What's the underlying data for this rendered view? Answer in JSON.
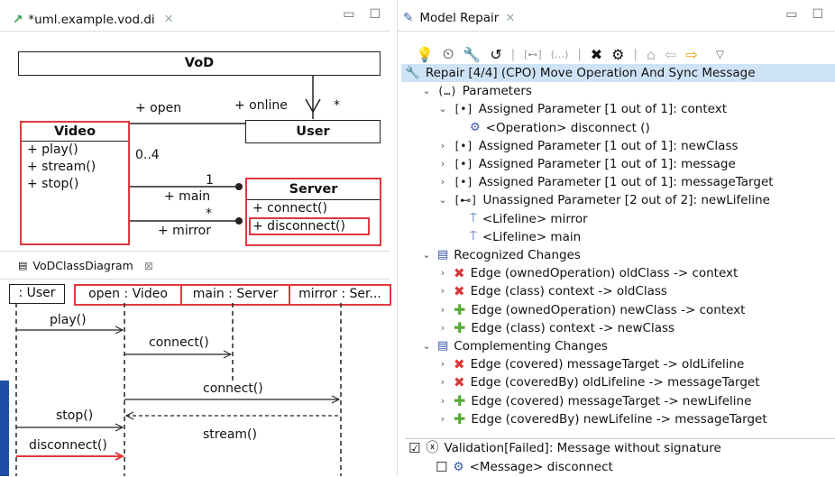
{
  "left_editor": {
    "tab_title": "*uml.example.vod.di",
    "class_diagram": {
      "vod_class": "VoD",
      "video_class": {
        "name": "Video",
        "ops": [
          "+ play()",
          "+ stream()",
          "+ stop()"
        ]
      },
      "user_class": "User",
      "server_class": {
        "name": "Server",
        "ops": [
          "+ connect()",
          "+ disconnect()"
        ]
      },
      "labels": {
        "open": "+ open",
        "online": "+ online",
        "star1": "*",
        "mult_04": "0..4",
        "one": "1",
        "main": "+ main",
        "star2": "*",
        "mirror": "+ mirror"
      }
    },
    "diagram_tab": "VoDClassDiagram",
    "sequence": {
      "lifelines": [
        ": User",
        "open : Video",
        "main : Server",
        "mirror : Ser..."
      ],
      "messages": [
        "play()",
        "connect()",
        "connect()",
        "stop()",
        "stream()",
        "disconnect()"
      ]
    }
  },
  "right_panel": {
    "tab_title": "Model Repair",
    "tree": [
      {
        "text": "Repair [4/4] (CPO) Move Operation And Sync Message",
        "indent": 0,
        "icon": "wrench-icon",
        "chev": "",
        "selected": true
      },
      {
        "text": "Parameters",
        "indent": 1,
        "icon": "param-group-icon",
        "chev": "v"
      },
      {
        "text": "Assigned Parameter [1 out of 1]: context",
        "indent": 2,
        "icon": "param-icon",
        "chev": "v"
      },
      {
        "text": "<Operation> disconnect ()",
        "indent": 3,
        "icon": "gear-icon",
        "chev": ""
      },
      {
        "text": "Assigned Parameter [1 out of 1]: newClass",
        "indent": 2,
        "icon": "param-icon",
        "chev": ">"
      },
      {
        "text": "Assigned Parameter [1 out of 1]: message",
        "indent": 2,
        "icon": "param-icon",
        "chev": ">"
      },
      {
        "text": "Assigned Parameter [1 out of 1]: messageTarget",
        "indent": 2,
        "icon": "param-icon",
        "chev": ">"
      },
      {
        "text": "Unassigned Parameter [2 out of 2]: newLifeline",
        "indent": 2,
        "icon": "unassigned-param-icon",
        "chev": "v"
      },
      {
        "text": "<Lifeline> mirror",
        "indent": 3,
        "icon": "lifeline-icon",
        "chev": ""
      },
      {
        "text": "<Lifeline> main",
        "indent": 3,
        "icon": "lifeline-icon",
        "chev": ""
      },
      {
        "text": "Recognized Changes",
        "indent": 1,
        "icon": "changes-icon",
        "chev": "v"
      },
      {
        "text": "Edge (ownedOperation) oldClass -> context",
        "indent": 2,
        "icon": "remove-icon",
        "chev": ">"
      },
      {
        "text": "Edge (class) context -> oldClass",
        "indent": 2,
        "icon": "remove-icon",
        "chev": ">"
      },
      {
        "text": "Edge (ownedOperation) newClass -> context",
        "indent": 2,
        "icon": "add-icon",
        "chev": ">"
      },
      {
        "text": "Edge (class) context -> newClass",
        "indent": 2,
        "icon": "add-icon",
        "chev": ">"
      },
      {
        "text": "Complementing Changes",
        "indent": 1,
        "icon": "changes-icon",
        "chev": "v"
      },
      {
        "text": "Edge (covered) messageTarget -> oldLifeline",
        "indent": 2,
        "icon": "remove-icon",
        "chev": ">"
      },
      {
        "text": "Edge (coveredBy) oldLifeline -> messageTarget",
        "indent": 2,
        "icon": "remove-icon",
        "chev": ">"
      },
      {
        "text": "Edge (covered) messageTarget -> newLifeline",
        "indent": 2,
        "icon": "add-icon",
        "chev": ">"
      },
      {
        "text": "Edge (coveredBy) newLifeline -> messageTarget",
        "indent": 2,
        "icon": "add-icon",
        "chev": ">"
      }
    ],
    "validation": {
      "status": "Validation[Failed]: Message without signature",
      "item": "<Message> disconnect"
    }
  }
}
